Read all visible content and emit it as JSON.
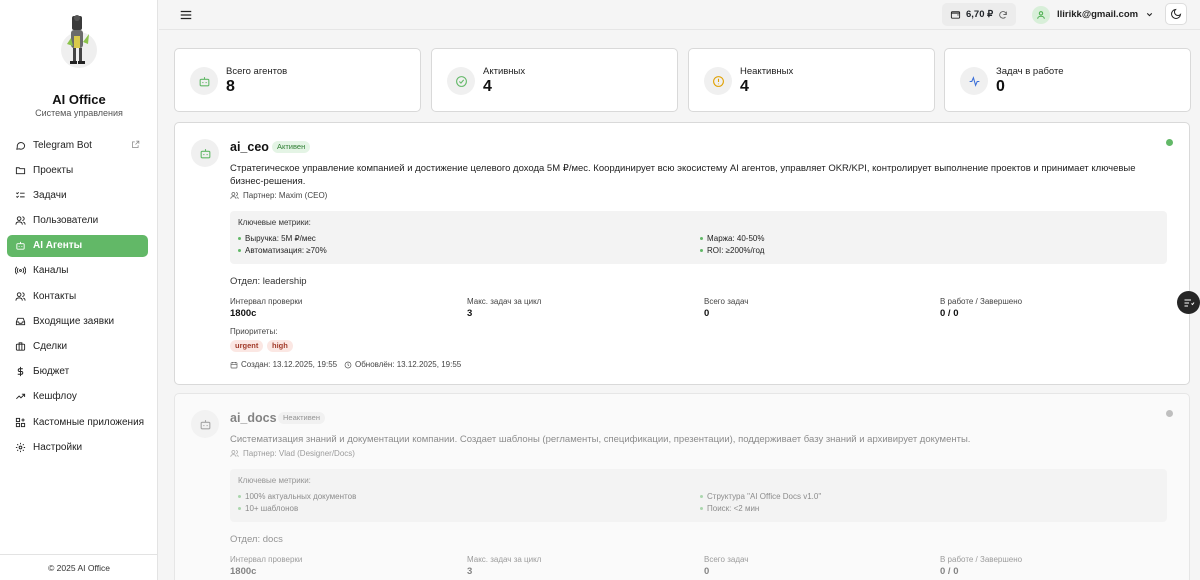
{
  "sidebar": {
    "brand_title": "AI Office",
    "brand_subtitle": "Система управления",
    "items": [
      {
        "label": "Telegram Bot",
        "icon": "message-circle-icon",
        "active": false
      },
      {
        "label": "Проекты",
        "icon": "folder-icon",
        "active": false
      },
      {
        "label": "Задачи",
        "icon": "list-checks-icon",
        "active": false
      },
      {
        "label": "Пользователи",
        "icon": "users-icon",
        "active": false
      },
      {
        "label": "AI Агенты",
        "icon": "bot-icon",
        "active": true
      },
      {
        "label": "Каналы",
        "icon": "radio-icon",
        "active": false
      },
      {
        "label": "Контакты",
        "icon": "contacts-icon",
        "active": false
      },
      {
        "label": "Входящие заявки",
        "icon": "inbox-icon",
        "active": false
      },
      {
        "label": "Сделки",
        "icon": "briefcase-icon",
        "active": false
      },
      {
        "label": "Бюджет",
        "icon": "dollar-icon",
        "active": false
      },
      {
        "label": "Кешфлоу",
        "icon": "trend-up-icon",
        "active": false
      },
      {
        "label": "Кастомные приложения",
        "icon": "grid-plus-icon",
        "active": false
      },
      {
        "label": "Настройки",
        "icon": "gear-icon",
        "active": false
      }
    ],
    "footer": "© 2025 AI Office"
  },
  "topbar": {
    "balance": "6,70 ₽",
    "user_email": "llirikk@gmail.com"
  },
  "stats": [
    {
      "label": "Всего агентов",
      "value": "8",
      "icon": "bot-icon"
    },
    {
      "label": "Активных",
      "value": "4",
      "icon": "check-circle-icon"
    },
    {
      "label": "Неактивных",
      "value": "4",
      "icon": "alert-circle-icon"
    },
    {
      "label": "Задач в работе",
      "value": "0",
      "icon": "activity-icon"
    }
  ],
  "labels": {
    "metrics_title": "Ключевые метрики:",
    "interval": "Интервал проверки",
    "max_tasks": "Макс. задач за цикл",
    "total_tasks": "Всего задач",
    "in_progress": "В работе / Завершено",
    "priorities": "Приоритеты:"
  },
  "agents": [
    {
      "name": "ai_ceo",
      "status": "Активен",
      "status_color": "#62b867",
      "description": "Стратегическое управление компанией и достижение целевого дохода 5М ₽/мес. Координирует всю экосистему AI агентов, управляет OKR/KPI, контролирует выполнение проектов и принимает ключевые бизнес-решения.",
      "partner": "Партнер: Maxim (CEO)",
      "metrics": [
        "Выручка: 5М ₽/мес",
        "Маржа: 40-50%",
        "Автоматизация: ≥70%",
        "ROI: ≥200%/год"
      ],
      "department": "Отдел: leadership",
      "interval": "1800с",
      "max_tasks": "3",
      "total_tasks": "0",
      "in_progress": "0 / 0",
      "priorities": [
        "urgent",
        "high"
      ],
      "created": "Создан: 13.12.2025, 19:55",
      "updated": "Обновлён: 13.12.2025, 19:55"
    },
    {
      "name": "ai_docs",
      "status": "Неактивен",
      "status_color": "#9e9e9e",
      "description": "Систематизация знаний и документации компании. Создает шаблоны (регламенты, спецификации, презентации), поддерживает базу знаний и архивирует документы.",
      "partner": "Партнер: Vlad (Designer/Docs)",
      "metrics": [
        "100% актуальных документов",
        "Структура \"AI Office Docs v1.0\"",
        "10+ шаблонов",
        "Поиск: <2 мин"
      ],
      "department": "Отдел: docs",
      "interval": "1800с",
      "max_tasks": "3",
      "total_tasks": "0",
      "in_progress": "0 / 0"
    }
  ]
}
